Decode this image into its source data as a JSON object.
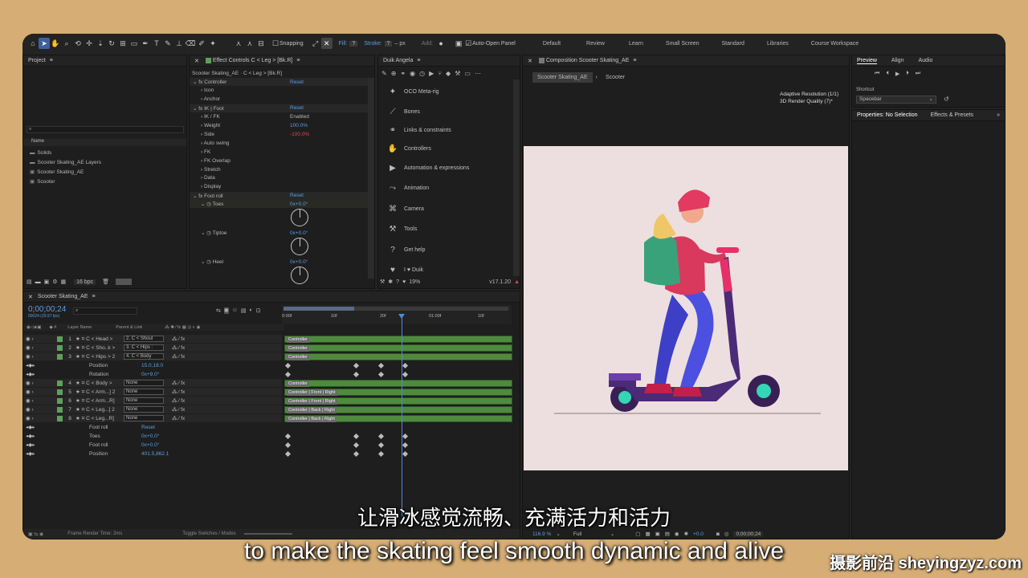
{
  "toolbar": {
    "snapping": "Snapping",
    "fill": "Fill:",
    "fill_val": "?",
    "stroke": "Stroke:",
    "stroke_val": "?",
    "px": "– px",
    "add": "Add:",
    "auto_open": "Auto-Open Panel",
    "workspaces": [
      "Default",
      "Review",
      "Learn",
      "Small Screen",
      "Standard",
      "Libraries",
      "Course Workspace"
    ]
  },
  "project": {
    "title": "Project",
    "col_name": "Name",
    "items": [
      "Solids",
      "Scooter Skating_AE Layers",
      "Scooter Skating_AE",
      "Scooter"
    ],
    "bpc": "16 bpc"
  },
  "effects": {
    "title": "Effect Controls C < Leg > [Bk.R]",
    "path": "Scooter Skating_AE · C < Leg > [Bk.R]",
    "rows": [
      {
        "label": "Controller",
        "value": "Reset",
        "vclass": "blue"
      },
      {
        "label": "Icon",
        "value": "",
        "vclass": ""
      },
      {
        "label": "Anchor",
        "value": "",
        "vclass": ""
      },
      {
        "label": "IK | Foot",
        "value": "Reset",
        "vclass": "blue"
      },
      {
        "label": "IK / FK",
        "value": "Enabled",
        "vclass": ""
      },
      {
        "label": "Weight",
        "value": "100.0%",
        "vclass": "blue"
      },
      {
        "label": "Side",
        "value": "-100.0%",
        "vclass": "red"
      },
      {
        "label": "Auto swing",
        "value": "",
        "vclass": ""
      },
      {
        "label": "FK",
        "value": "",
        "vclass": ""
      },
      {
        "label": "FK Overlap",
        "value": "",
        "vclass": ""
      },
      {
        "label": "Stretch",
        "value": "",
        "vclass": ""
      },
      {
        "label": "Data",
        "value": "",
        "vclass": ""
      },
      {
        "label": "Display",
        "value": "",
        "vclass": ""
      },
      {
        "label": "Foot roll",
        "value": "Reset",
        "vclass": "blue"
      }
    ],
    "dials": [
      {
        "label": "Toes",
        "value": "0x+0.0°"
      },
      {
        "label": "Tiptoe",
        "value": "0x+0.0°"
      },
      {
        "label": "Heel",
        "value": "0x+0.0°"
      }
    ]
  },
  "duik": {
    "title": "Duik Angela",
    "menu": [
      "OCO Meta-rig",
      "Bones",
      "Links & constraints",
      "Controllers",
      "Automation & expressions",
      "Animation",
      "Camera",
      "Tools",
      "Get help",
      "I ♥ Duik"
    ],
    "percent": "19%",
    "version": "v17.1.20"
  },
  "comp": {
    "title": "Composition Scooter Skating_AE",
    "tab1": "Scooter Skating_AE",
    "tab2": "Scooter",
    "res": "Adaptive Resolution (1/1)",
    "quality": "3D Render Quality (7)*",
    "zoom": "116.9 %",
    "full": "Full",
    "offset": "+0.0",
    "time": "0;00;00;24"
  },
  "preview": {
    "tabs": [
      "Preview",
      "Align",
      "Audio"
    ],
    "shortcut_label": "Shortcut",
    "shortcut": "Spacebar",
    "props": "Properties: No Selection",
    "effects": "Effects & Presets"
  },
  "timeline": {
    "title": "Scooter Skating_AE",
    "timecode": "0;00;00;24",
    "fps": "00024 (29.97 fps)",
    "col_layer": "Layer Name",
    "col_parent": "Parent & Link",
    "ruler": [
      "0:00f",
      "10f",
      "20f",
      "01:00f",
      "10f"
    ],
    "layers": [
      {
        "num": "1",
        "name": "C < Head >",
        "parent": "2. C < Shoul"
      },
      {
        "num": "2",
        "name": "C < Sho..k >",
        "parent": "3. C < Hips :"
      },
      {
        "num": "3",
        "name": "C < Hips > 2",
        "parent": "4. C < Body"
      },
      {
        "num": "",
        "name": "Position",
        "parent": "15.0,18.0"
      },
      {
        "num": "",
        "name": "Rotation",
        "parent": "0x+9.0°"
      },
      {
        "num": "4",
        "name": "C < Body >",
        "parent": "None"
      },
      {
        "num": "5",
        "name": "C < Arm...] 2",
        "parent": "None"
      },
      {
        "num": "6",
        "name": "C < Arm...R]",
        "parent": "None"
      },
      {
        "num": "7",
        "name": "C < Leg...] 2",
        "parent": "None"
      },
      {
        "num": "8",
        "name": "C < Leg...R]",
        "parent": "None"
      },
      {
        "num": "",
        "name": "Foot roll",
        "parent": "Reset"
      },
      {
        "num": "",
        "name": "Toes",
        "parent": "0x+0.0°"
      },
      {
        "num": "",
        "name": "Foot roll",
        "parent": "0x+0.0°"
      },
      {
        "num": "",
        "name": "Position",
        "parent": "401.5,862.1"
      }
    ],
    "tracks": [
      "Controller",
      "Controller",
      "Controller",
      "Controller",
      "Controller | Front | Right",
      "Controller | Front | Right",
      "Controller | Back | Right",
      "Controller | Back | Right"
    ],
    "render_time": "Frame Render Time: 2ms",
    "toggle": "Toggle Switches / Modes"
  },
  "subtitles": {
    "zh": "让滑冰感觉流畅、充满活力和活力",
    "en": "to make the skating feel smooth dynamic and alive"
  },
  "watermark": "摄影前沿 sheyingzyz.com"
}
